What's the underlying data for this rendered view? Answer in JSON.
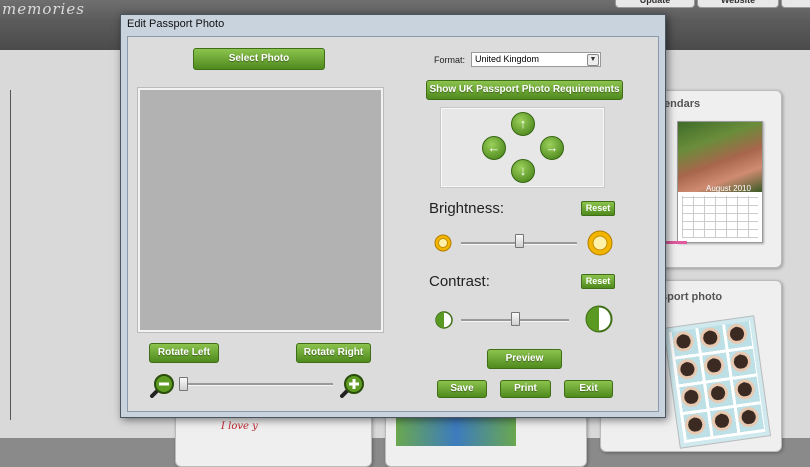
{
  "background": {
    "logo": "memories",
    "tabs": [
      "Update",
      "Website"
    ],
    "cards": [
      {
        "title": "lendars",
        "photo_caption": "August 2010"
      },
      {
        "title": "sport photo"
      }
    ],
    "bottom_caption": "I love y"
  },
  "dialog": {
    "title": "Edit Passport Photo",
    "select_photo_label": "Select Photo",
    "format_label": "Format:",
    "format_value": "United Kingdom",
    "requirements_label": "Show UK Passport Photo Requirements",
    "arrows": [
      "up",
      "left",
      "right",
      "down"
    ],
    "brightness": {
      "label": "Brightness:",
      "reset_label": "Reset",
      "value": 0.5
    },
    "contrast": {
      "label": "Contrast:",
      "reset_label": "Reset",
      "value": 0.5
    },
    "preview_label": "Preview",
    "rotate_left_label": "Rotate Left",
    "rotate_right_label": "Rotate Right",
    "zoom_value": 0.0,
    "save_label": "Save",
    "print_label": "Print",
    "exit_label": "Exit"
  },
  "colors": {
    "button_green": "#5b9a22",
    "dialog_bg": "#dcdcdc",
    "photo_placeholder": "#b2b2b2"
  }
}
